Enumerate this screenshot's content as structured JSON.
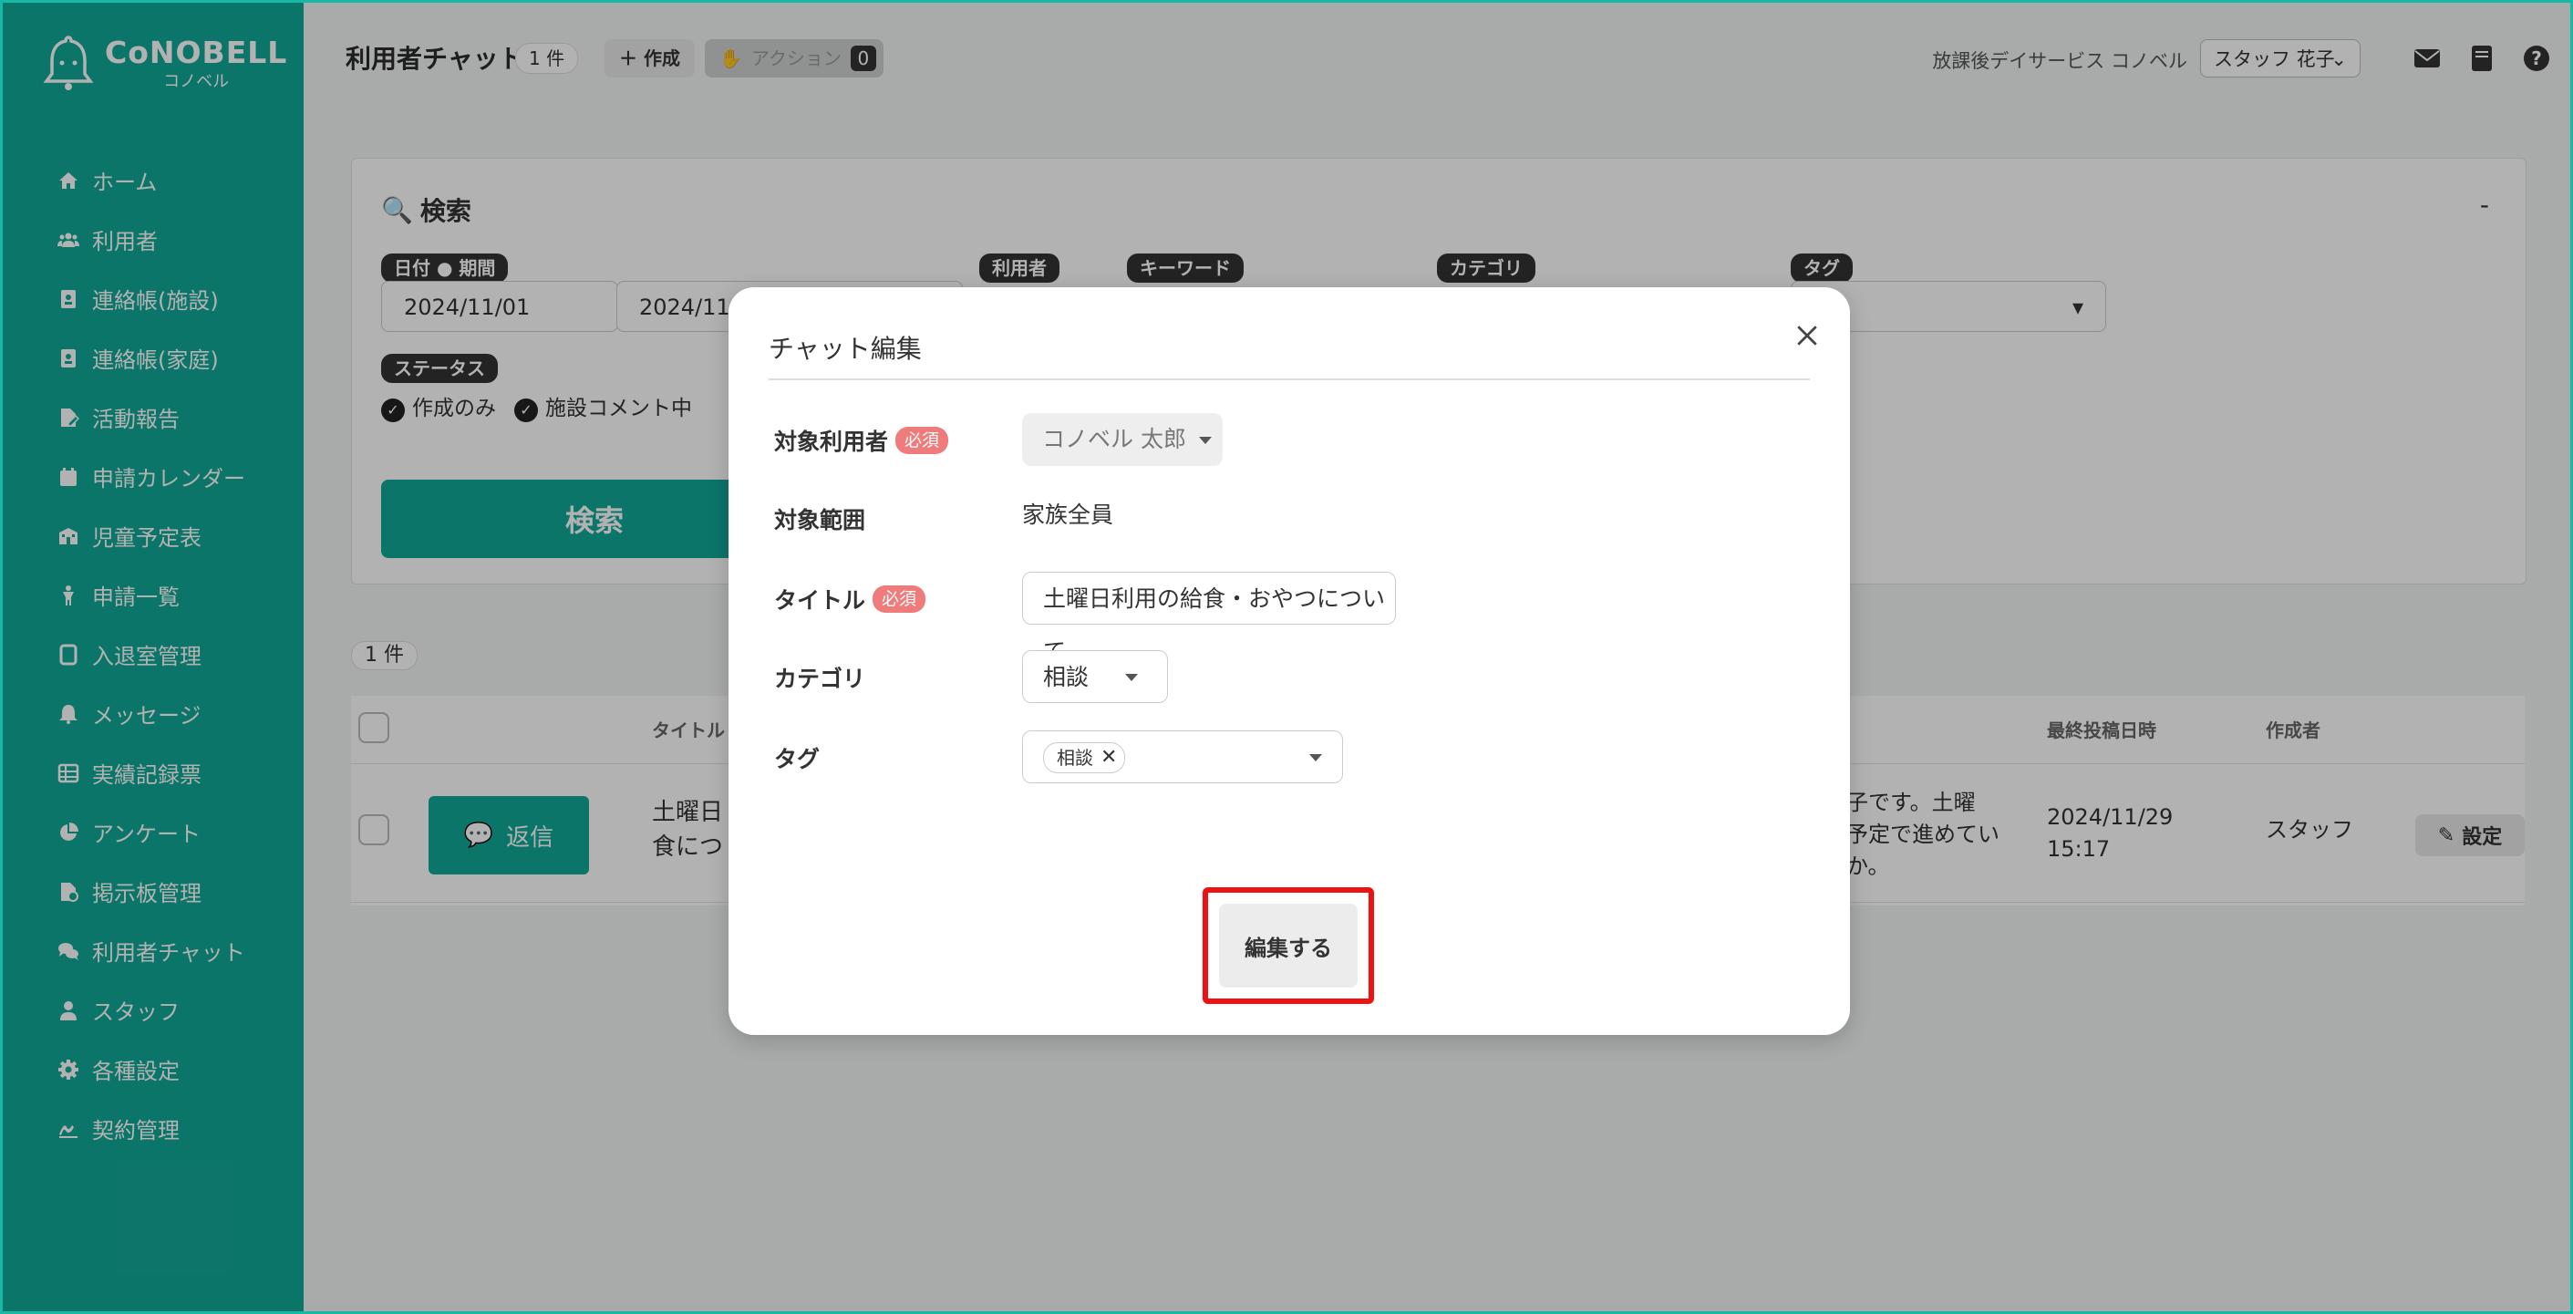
{
  "brand": {
    "name": "CoNOBELL",
    "sub": "コノベル"
  },
  "sidebar": {
    "items": [
      {
        "label": "ホーム",
        "icon": "home-icon"
      },
      {
        "label": "利用者",
        "icon": "users-icon"
      },
      {
        "label": "連絡帳(施設)",
        "icon": "contact-book-icon"
      },
      {
        "label": "連絡帳(家庭)",
        "icon": "contact-book-icon"
      },
      {
        "label": "活動報告",
        "icon": "report-icon"
      },
      {
        "label": "申請カレンダー",
        "icon": "calendar-icon"
      },
      {
        "label": "児童予定表",
        "icon": "schedule-icon"
      },
      {
        "label": "申請一覧",
        "icon": "child-icon"
      },
      {
        "label": "入退室管理",
        "icon": "tablet-icon"
      },
      {
        "label": "メッセージ",
        "icon": "bell-icon"
      },
      {
        "label": "実績記録票",
        "icon": "table-icon"
      },
      {
        "label": "アンケート",
        "icon": "pie-chart-icon"
      },
      {
        "label": "掲示板管理",
        "icon": "board-icon"
      },
      {
        "label": "利用者チャット",
        "icon": "chat-icon"
      },
      {
        "label": "スタッフ",
        "icon": "staff-icon"
      },
      {
        "label": "各種設定",
        "icon": "gear-icon"
      },
      {
        "label": "契約管理",
        "icon": "contract-icon"
      }
    ]
  },
  "header": {
    "title": "利用者チャット",
    "count": "1 件",
    "create_label": "作成",
    "action_label": "アクション",
    "action_count": "0",
    "facility": "放課後デイサービス コノベル",
    "staff": "スタッフ 花子"
  },
  "search": {
    "title": "検索",
    "collapse": "-",
    "date_label": "日付",
    "period_label": "期間",
    "date_from": "2024/11/01",
    "date_sep": "~",
    "date_to": "2024/11/",
    "user_label": "利用者",
    "keyword_label": "キーワード",
    "category_label": "カテゴリ",
    "tag_label": "タグ",
    "status_label": "ステータス",
    "status_options": [
      "作成のみ",
      "施設コメント中"
    ],
    "button": "検索"
  },
  "results": {
    "count": "1 件",
    "headers": {
      "title": "タイトル",
      "last_post": "最終投稿日時",
      "author": "作成者"
    },
    "row": {
      "reply": "返信",
      "title_line1": "土曜日",
      "title_line2": "食につ",
      "excerpt_line1": "子です。土曜",
      "excerpt_line2": "予定で進めてい",
      "excerpt_line3": "か。",
      "last_post_date": "2024/11/29",
      "last_post_time": "15:17",
      "author": "スタッフ",
      "settings": "設定"
    }
  },
  "modal": {
    "title": "チャット編集",
    "required": "必須",
    "target_user_label": "対象利用者",
    "target_user_value": "コノベル 太郎",
    "scope_label": "対象範囲",
    "scope_value": "家族全員",
    "title_label": "タイトル",
    "title_value": "土曜日利用の給食・おやつについて",
    "category_label": "カテゴリ",
    "category_value": "相談",
    "tag_label": "タグ",
    "tag_value": "相談",
    "submit": "編集する"
  },
  "colors": {
    "brand": "#12a897",
    "required": "#f07b7b",
    "highlight": "#ee1111"
  }
}
